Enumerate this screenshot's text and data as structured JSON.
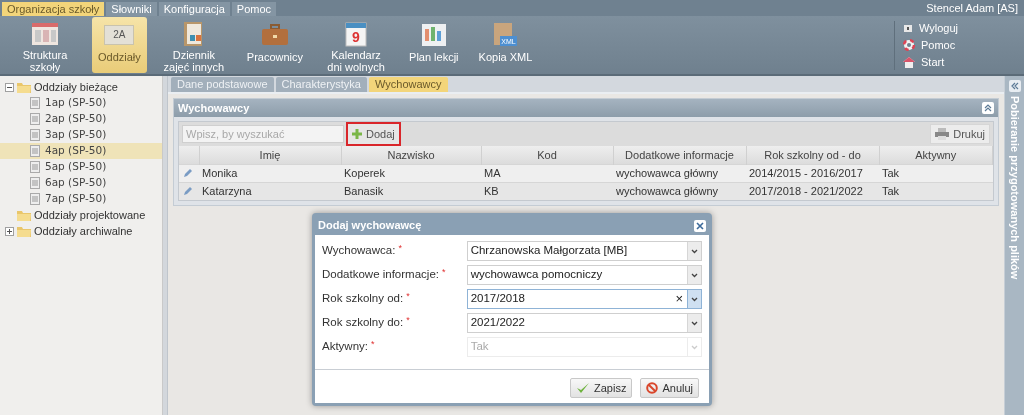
{
  "menu_tabs": [
    {
      "label": "Organizacja szkoły",
      "selected": true
    },
    {
      "label": "Słowniki",
      "selected": false
    },
    {
      "label": "Konfiguracja",
      "selected": false
    },
    {
      "label": "Pomoc",
      "selected": false
    }
  ],
  "user": "Stencel Adam [AS]",
  "toolbar": [
    {
      "label": "Struktura szkoły",
      "kind": "structure",
      "selected": false
    },
    {
      "label": "Oddziały",
      "kind": "class",
      "selected": true
    },
    {
      "label": "Dziennik zajęć innych",
      "kind": "journal",
      "selected": false
    },
    {
      "label": "Pracownicy",
      "kind": "briefcase",
      "selected": false
    },
    {
      "label": "Kalendarz dni wolnych",
      "kind": "calendar",
      "selected": false
    },
    {
      "label": "Plan lekcji",
      "kind": "plan",
      "selected": false
    },
    {
      "label": "Kopia XML",
      "kind": "xml",
      "selected": false
    }
  ],
  "class_icon_text": "2A",
  "calendar_icon_text": "9",
  "xml_icon_text": "XML",
  "quick_links": [
    {
      "label": "Wyloguj",
      "kind": "logout"
    },
    {
      "label": "Pomoc",
      "kind": "help"
    },
    {
      "label": "Start",
      "kind": "home"
    }
  ],
  "tree": [
    {
      "label": "Oddziały bieżące",
      "expanded": true,
      "children": [
        {
          "label": "1ap (SP-50)",
          "selected": false
        },
        {
          "label": "2ap (SP-50)",
          "selected": false
        },
        {
          "label": "3ap (SP-50)",
          "selected": false
        },
        {
          "label": "4ap (SP-50)",
          "selected": true
        },
        {
          "label": "5ap (SP-50)",
          "selected": false
        },
        {
          "label": "6ap (SP-50)",
          "selected": false
        },
        {
          "label": "7ap (SP-50)",
          "selected": false
        }
      ]
    },
    {
      "label": "Oddziały projektowane"
    },
    {
      "label": "Oddziały archiwalne",
      "expanded": false
    }
  ],
  "content_tabs": [
    {
      "label": "Dane podstawowe",
      "selected": false
    },
    {
      "label": "Charakterystyka",
      "selected": false
    },
    {
      "label": "Wychowawcy",
      "selected": true
    }
  ],
  "panel": {
    "title": "Wychowawcy",
    "search": {
      "placeholder": "Wpisz, by wyszukać"
    },
    "add_button": {
      "label": "Dodaj",
      "highlighted": true
    },
    "print_button": "Drukuj",
    "table": {
      "columns": [
        "Imię",
        "Nazwisko",
        "Kod",
        "Dodatkowe informacje",
        "Rok szkolny od - do",
        "Aktywny"
      ],
      "rows": [
        [
          "Monika",
          "Koperek",
          "MA",
          "wychowawca główny",
          "2014/2015 - 2016/2017",
          "Tak"
        ],
        [
          "Katarzyna",
          "Banasik",
          "KB",
          "wychowawca główny",
          "2017/2018 - 2021/2022",
          "Tak"
        ]
      ]
    }
  },
  "dialog": {
    "title": "Dodaj wychowawcę",
    "fields": [
      {
        "label": "Wychowawca:",
        "required_mark": "*",
        "value": "Chrzanowska Małgorzata [MB]",
        "disabled": false,
        "focused": false
      },
      {
        "label": "Dodatkowe informacje:",
        "required_mark": "*",
        "value": "wychowawca pomocniczy",
        "disabled": false,
        "focused": false
      },
      {
        "label": "Rok szkolny od:",
        "required_mark": "*",
        "value": "2017/2018",
        "disabled": false,
        "focused": true,
        "clear_mark": "×"
      },
      {
        "label": "Rok szkolny do:",
        "required_mark": "*",
        "value": "2021/2022",
        "disabled": false,
        "focused": false
      },
      {
        "label": "Aktywny:",
        "required_mark": "*",
        "value": "Tak",
        "disabled": true,
        "focused": false
      }
    ],
    "buttons": [
      {
        "label": "Zapisz",
        "kind": "save"
      },
      {
        "label": "Anuluj",
        "kind": "cancel"
      }
    ]
  },
  "side_panel": {
    "title": "Pobieranie przygotowanych plików"
  }
}
